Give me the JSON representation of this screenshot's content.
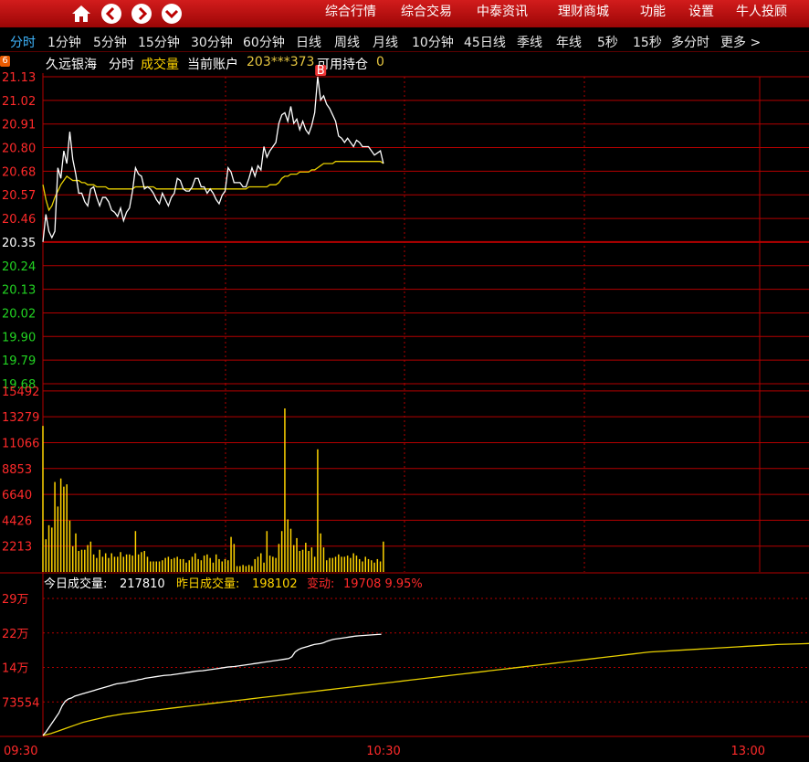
{
  "menu": {
    "icons": [
      "home-icon",
      "back-icon",
      "forward-icon",
      "dropdown-icon"
    ],
    "items": [
      "综合行情",
      "综合交易",
      "中泰资讯",
      "理财商城",
      "功能",
      "设置",
      "牛人投顾"
    ]
  },
  "periods": {
    "items": [
      "分时",
      "1分钟",
      "5分钟",
      "15分钟",
      "30分钟",
      "60分钟",
      "日线",
      "周线",
      "月线",
      "10分钟",
      "45日线",
      "季线",
      "年线",
      "5秒",
      "15秒",
      "多分时",
      "更多 >"
    ],
    "active": "分时"
  },
  "info": {
    "badge": "6",
    "stock_name": "久远银海",
    "mode": "分时",
    "volume_label": "成交量",
    "account_label": "当前账户",
    "account": "203***373",
    "position_label": "可用持仓",
    "position": "0"
  },
  "vol_info": {
    "today_label": "今日成交量:",
    "today_value": "217810",
    "yesterday_label": "昨日成交量:",
    "yesterday_value": "198102",
    "change_label": "变动:",
    "change_value": "19708 9.95%"
  },
  "colors": {
    "price_up": "#ff2a2a",
    "price_base": "#ffffff",
    "price_down": "#22d322",
    "volume": "#ffd400",
    "grid": "#b40000",
    "topbar": "#c01010",
    "active_tab": "#3fb6ff"
  },
  "chart_data": [
    {
      "type": "line",
      "panel": "intraday-price",
      "y_ticks": [
        "21.13",
        "21.02",
        "20.91",
        "20.80",
        "20.68",
        "20.57",
        "20.46",
        "20.35",
        "20.24",
        "20.13",
        "20.02",
        "19.90",
        "19.79",
        "19.68"
      ],
      "ylim": [
        19.68,
        21.13
      ],
      "prev_close": 20.35,
      "marker": {
        "label": "B",
        "x_index": 93,
        "y": 21.13
      },
      "series": [
        {
          "values": [
            20.35,
            20.48,
            20.4,
            20.37,
            20.4,
            20.7,
            20.65,
            20.78,
            20.72,
            20.87,
            20.74,
            20.67,
            20.58,
            20.58,
            20.54,
            20.52,
            20.6,
            20.61,
            20.56,
            20.52,
            20.56,
            20.56,
            20.54,
            20.5,
            20.49,
            20.47,
            20.51,
            20.45,
            20.49,
            20.51,
            20.59,
            20.7,
            20.67,
            20.66,
            20.6,
            20.61,
            20.6,
            20.58,
            20.55,
            20.53,
            20.58,
            20.55,
            20.52,
            20.56,
            20.58,
            20.65,
            20.64,
            20.6,
            20.59,
            20.59,
            20.61,
            20.65,
            20.65,
            20.61,
            20.61,
            20.58,
            20.6,
            20.58,
            20.55,
            20.53,
            20.57,
            20.59,
            20.7,
            20.68,
            20.63,
            20.63,
            20.63,
            20.61,
            20.61,
            20.65,
            20.7,
            20.66,
            20.71,
            20.69,
            20.8,
            20.75,
            20.78,
            20.8,
            20.82,
            20.91,
            20.95,
            20.96,
            20.92,
            20.99,
            20.91,
            20.93,
            20.88,
            20.92,
            20.88,
            20.86,
            20.9,
            20.96,
            21.13,
            21.02,
            21.04,
            21.0,
            20.98,
            20.95,
            20.92,
            20.85,
            20.84,
            20.82,
            20.84,
            20.82,
            20.8,
            20.83,
            20.82,
            20.8,
            20.8,
            20.8,
            20.78,
            20.76,
            20.77,
            20.78,
            20.72
          ]
        },
        {
          "values": [
            20.62,
            20.55,
            20.5,
            20.52,
            20.56,
            20.59,
            20.62,
            20.64,
            20.66,
            20.65,
            20.64,
            20.64,
            20.64,
            20.63,
            20.63,
            20.62,
            20.62,
            20.62,
            20.61,
            20.61,
            20.61,
            20.61,
            20.6,
            20.6,
            20.6,
            20.6,
            20.6,
            20.6,
            20.6,
            20.6,
            20.6,
            20.61,
            20.61,
            20.61,
            20.61,
            20.61,
            20.61,
            20.61,
            20.6,
            20.6,
            20.6,
            20.6,
            20.6,
            20.6,
            20.6,
            20.6,
            20.6,
            20.6,
            20.6,
            20.6,
            20.6,
            20.6,
            20.6,
            20.6,
            20.6,
            20.6,
            20.6,
            20.6,
            20.6,
            20.6,
            20.6,
            20.6,
            20.6,
            20.6,
            20.6,
            20.6,
            20.6,
            20.6,
            20.6,
            20.61,
            20.61,
            20.61,
            20.61,
            20.61,
            20.61,
            20.61,
            20.62,
            20.62,
            20.62,
            20.63,
            20.65,
            20.66,
            20.66,
            20.67,
            20.67,
            20.67,
            20.68,
            20.68,
            20.68,
            20.68,
            20.69,
            20.69,
            20.7,
            20.71,
            20.72,
            20.72,
            20.72,
            20.72,
            20.73,
            20.73,
            20.73,
            20.73,
            20.73,
            20.73,
            20.73,
            20.73,
            20.73,
            20.73,
            20.73,
            20.73,
            20.73,
            20.73,
            20.73,
            20.73,
            20.72
          ]
        }
      ]
    },
    {
      "type": "bar",
      "panel": "intraday-volume",
      "y_ticks": [
        "15492",
        "13279",
        "11066",
        "8853",
        "6640",
        "4426",
        "2213"
      ],
      "ylim": [
        0,
        15492
      ],
      "values": [
        12500,
        2800,
        4000,
        3800,
        7700,
        5600,
        8000,
        7300,
        7500,
        4400,
        2200,
        3300,
        1800,
        1900,
        1900,
        2300,
        2600,
        1500,
        1200,
        1900,
        1300,
        1600,
        1200,
        1600,
        1300,
        1300,
        1700,
        1300,
        1500,
        1500,
        1400,
        3500,
        1500,
        1700,
        1800,
        1300,
        900,
        900,
        900,
        900,
        1000,
        1200,
        1300,
        1100,
        1200,
        1300,
        1100,
        1100,
        800,
        1000,
        1300,
        1600,
        1100,
        1000,
        1400,
        1500,
        1200,
        800,
        1500,
        1100,
        900,
        1100,
        1000,
        3000,
        2400,
        500,
        500,
        600,
        500,
        600,
        500,
        1100,
        1300,
        1600,
        800,
        3500,
        1400,
        1300,
        1200,
        2400,
        3500,
        14000,
        4500,
        3700,
        2300,
        2900,
        1800,
        1900,
        2500,
        1800,
        2100,
        1300,
        10500,
        3300,
        2100,
        1000,
        1200,
        1200,
        1300,
        1500,
        1300,
        1300,
        1400,
        1200,
        1600,
        1400,
        1100,
        900,
        1300,
        1100,
        1000,
        800,
        1100,
        900,
        2600
      ]
    },
    {
      "type": "line",
      "panel": "cumulative-volume",
      "x_ticks": [
        "09:30",
        "10:30",
        "13:00"
      ],
      "y_ticks": [
        "29万",
        "22万",
        "14万",
        "73554"
      ],
      "ylim": [
        0,
        294216
      ],
      "series": [
        {
          "name": "今日成交量",
          "values": [
            2000,
            10000,
            20000,
            30000,
            40000,
            50000,
            65000,
            75000,
            80000,
            82000,
            86000,
            88000,
            90000,
            92000,
            94000,
            96000,
            98000,
            100000,
            102000,
            104000,
            106000,
            108000,
            110000,
            112000,
            113000,
            114000,
            115000,
            117000,
            118000,
            119000,
            121000,
            122000,
            124000,
            125000,
            126000,
            127000,
            128000,
            129000,
            130000,
            130500,
            131000,
            132000,
            133000,
            134000,
            135000,
            136000,
            137000,
            138000,
            139000,
            139500,
            140000,
            141000,
            142000,
            143000,
            144000,
            145000,
            146000,
            147000,
            148000,
            148500,
            149000,
            150000,
            151000,
            152000,
            153000,
            154000,
            155000,
            156000,
            157000,
            158000,
            159000,
            160000,
            161000,
            162000,
            163000,
            164000,
            165000,
            166000,
            170000,
            180000,
            185000,
            188000,
            190000,
            192000,
            194000,
            196000,
            197000,
            198000,
            200000,
            203000,
            205000,
            207000,
            208000,
            209000,
            210000,
            211000,
            212000,
            213000,
            214000,
            214500,
            215000,
            215500,
            216000,
            216500,
            217000,
            217500,
            217810
          ]
        },
        {
          "name": "昨日成交量",
          "values": [
            2000,
            6000,
            12000,
            18000,
            24000,
            30000,
            34000,
            38000,
            42000,
            45000,
            48000,
            50000,
            52000,
            54000,
            56000,
            58000,
            60000,
            62000,
            64000,
            66000,
            68000,
            70000,
            72000,
            74000,
            76000,
            78000,
            80000,
            82000,
            84000,
            86000,
            88000,
            90000,
            92000,
            94000,
            96000,
            98000,
            100000,
            102000,
            104000,
            106000,
            108000,
            110000,
            112000,
            114000,
            116000,
            118000,
            120000,
            122000,
            124000,
            126000,
            128000,
            130000,
            132000,
            134000,
            136000,
            138000,
            140000,
            142000,
            144000,
            146000,
            148000,
            150000,
            152000,
            154000,
            156000,
            158000,
            160000,
            162000,
            164000,
            166000,
            168000,
            170000,
            172000,
            174000,
            176000,
            178000,
            180000,
            181000,
            182000,
            183000,
            184000,
            185000,
            186000,
            187000,
            188000,
            189000,
            190000,
            191000,
            192000,
            193000,
            194000,
            195000,
            196000,
            196500,
            197000,
            197500,
            198102
          ]
        }
      ]
    }
  ]
}
